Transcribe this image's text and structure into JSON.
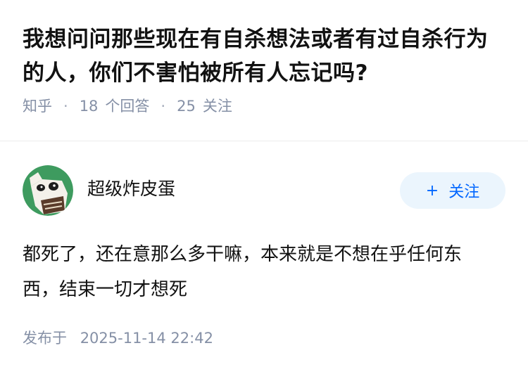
{
  "question": {
    "title": "我想问问那些现在有自杀想法或者有过自杀行为的人，你们不害怕被所有人忘记吗?",
    "source": "知乎",
    "answers_count": "18",
    "answers_label": "个回答",
    "followers_count": "25",
    "followers_label": "关注"
  },
  "answer": {
    "author_name": "超级炸皮蛋",
    "follow_label": "关注",
    "follow_icon": "plus-icon",
    "content": "都死了，还在意那么多干嘛，本来就是不想在乎任何东西，结束一切才想死",
    "published_label": "发布于",
    "published_time": "2025-11-14 22:42"
  },
  "colors": {
    "title": "#121212",
    "meta": "#8590a6",
    "follow_bg": "#ebf5fd",
    "follow_text": "#0066ff",
    "avatar_bg": "#3e9b5f"
  }
}
